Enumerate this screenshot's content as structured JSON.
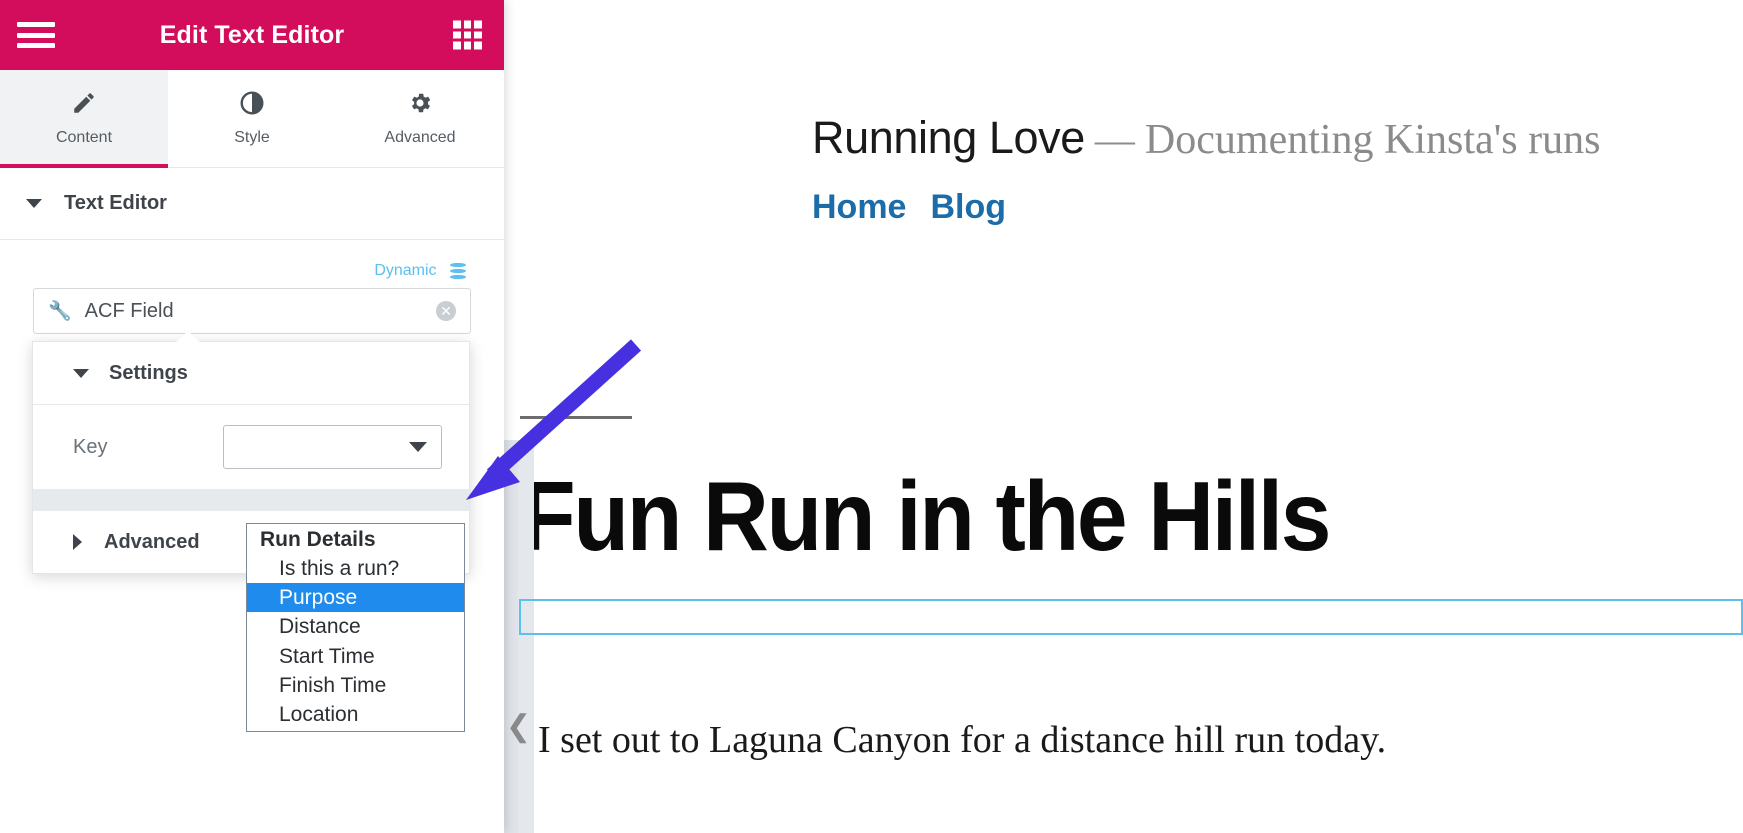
{
  "panel": {
    "header": {
      "title": "Edit Text Editor",
      "menu_icon": "hamburger-icon",
      "apps_icon": "grid-icon",
      "bg_color": "#d30c5c"
    },
    "tabs": [
      {
        "label": "Content",
        "icon": "pencil-icon",
        "active": true
      },
      {
        "label": "Style",
        "icon": "contrast-icon",
        "active": false
      },
      {
        "label": "Advanced",
        "icon": "gear-icon",
        "active": false
      }
    ],
    "widget_section": {
      "title": "Text Editor",
      "expanded": true
    },
    "dynamic": {
      "label": "Dynamic",
      "icon": "database-icon"
    },
    "acf_tag": {
      "label": "ACF Field",
      "icon": "wrench-icon",
      "clear_icon": "clear-circle-icon"
    },
    "popover": {
      "settings_title": "Settings",
      "key_label": "Key",
      "key_value": "",
      "advanced_title": "Advanced"
    }
  },
  "dropdown": {
    "group_label": "Run Details",
    "options": [
      {
        "label": "Is this a run?",
        "selected": false
      },
      {
        "label": "Purpose",
        "selected": true
      },
      {
        "label": "Distance",
        "selected": false
      },
      {
        "label": "Start Time",
        "selected": false
      },
      {
        "label": "Finish Time",
        "selected": false
      },
      {
        "label": "Location",
        "selected": false
      }
    ],
    "highlight_color": "#1f8ced"
  },
  "preview": {
    "site_title": "Running Love",
    "site_dash": "—",
    "site_tagline": "Documenting Kinsta's runs",
    "nav": [
      {
        "label": "Home"
      },
      {
        "label": "Blog"
      }
    ],
    "nav_color": "#1b6ca8",
    "post_title": "Fun Run in the Hills",
    "post_body": "I set out to Laguna Canyon for a distance hill run today.",
    "collapse_icon": "chevron-left-icon",
    "selection_color": "#5bc0f0"
  },
  "annotation": {
    "arrow_color": "#4630e0",
    "arrow_icon": "pointer-arrow"
  }
}
